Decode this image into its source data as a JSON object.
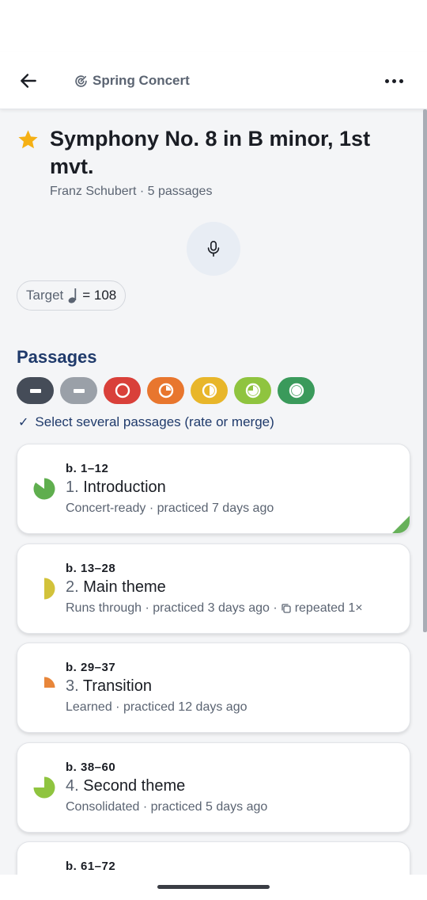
{
  "app_bar": {
    "back_icon": "arrow-left-icon",
    "breadcrumb_icon": "target-icon",
    "breadcrumb": "Spring Concert",
    "more_icon": "more-horizontal-icon"
  },
  "piece": {
    "favorite_icon": "star-icon",
    "favorite_color": "#f5b014",
    "title": "Symphony No. 8 in B minor, 1st mvt.",
    "subtitle": "Franz Schubert · 5 passages",
    "record_icon": "microphone-icon",
    "target_label": "Target",
    "target_icon": "quarter-note-icon",
    "target_value": "= 108"
  },
  "passages": {
    "section_title": "Passages",
    "filters": [
      {
        "name": "filter-all",
        "color": "#454c58",
        "glyph": "bar"
      },
      {
        "name": "filter-not-started",
        "color": "#9aa0a8",
        "glyph": "bar"
      },
      {
        "name": "filter-red",
        "color": "#d9403a",
        "glyph": "ring",
        "fill": 0
      },
      {
        "name": "filter-orange",
        "color": "#e8762e",
        "glyph": "ring",
        "fill": 0.25
      },
      {
        "name": "filter-yellow",
        "color": "#e8b62a",
        "glyph": "ring",
        "fill": 0.5
      },
      {
        "name": "filter-lime",
        "color": "#8fc43f",
        "glyph": "ring",
        "fill": 0.75
      },
      {
        "name": "filter-green",
        "color": "#3a9a5b",
        "glyph": "ring",
        "fill": 1
      }
    ],
    "select_icon": "check-icon",
    "select_label": "Select several passages (rate or merge)",
    "items": [
      {
        "bars": "b. 1–12",
        "num": "1.",
        "name": "Introduction",
        "status": "Concert-ready · practiced 7 days ago",
        "repeat": "",
        "progress": 0.85,
        "color": "#5fae4e",
        "corner": true
      },
      {
        "bars": "b. 13–28",
        "num": "2.",
        "name": "Main theme",
        "status": "Runs through · practiced 3 days ago ·",
        "repeat": "repeated 1×",
        "progress": 0.5,
        "color": "#d2c23a",
        "corner": false
      },
      {
        "bars": "b. 29–37",
        "num": "3.",
        "name": "Transition",
        "status": "Learned · practiced 12 days ago",
        "repeat": "",
        "progress": 0.25,
        "color": "#e8863a",
        "corner": false
      },
      {
        "bars": "b. 38–60",
        "num": "4.",
        "name": "Second theme",
        "status": "Consolidated · practiced 5 days ago",
        "repeat": "",
        "progress": 0.75,
        "color": "#8fc43f",
        "corner": false
      },
      {
        "bars": "b. 61–72",
        "num": "",
        "name": "",
        "status": "",
        "repeat": "",
        "progress": 0,
        "color": "#9aa0a8",
        "corner": false
      }
    ]
  }
}
